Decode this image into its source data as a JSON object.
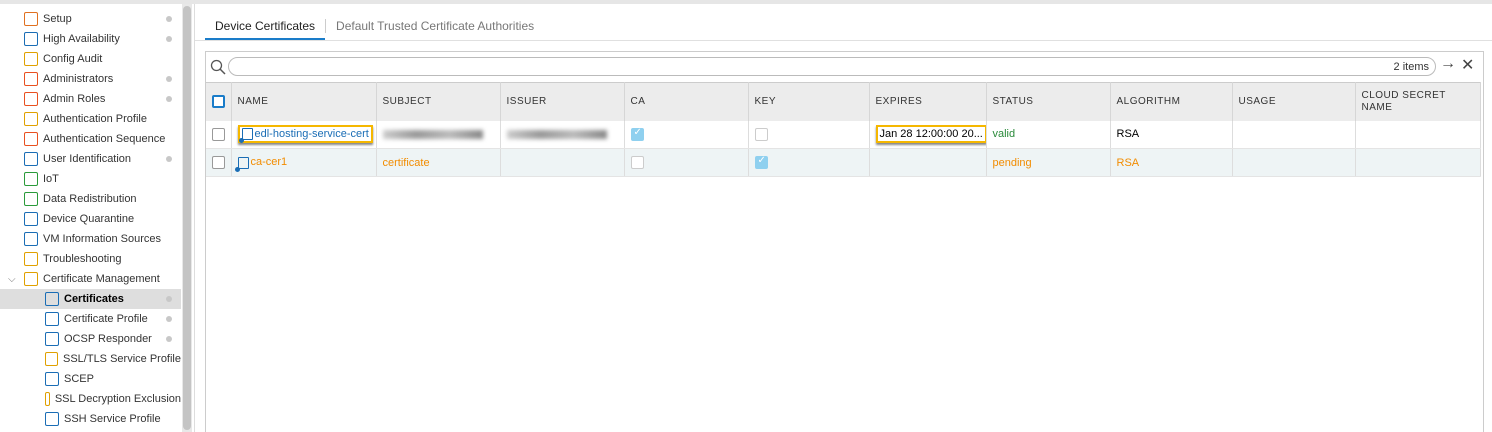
{
  "sidebar": {
    "items": [
      {
        "label": "Setup",
        "dot": true,
        "color": "#e07020"
      },
      {
        "label": "High Availability",
        "dot": true,
        "color": "#1a6db5"
      },
      {
        "label": "Config Audit",
        "dot": false,
        "color": "#e0a000"
      },
      {
        "label": "Administrators",
        "dot": true,
        "color": "#e85020"
      },
      {
        "label": "Admin Roles",
        "dot": true,
        "color": "#e85020"
      },
      {
        "label": "Authentication Profile",
        "dot": false,
        "color": "#e0a000"
      },
      {
        "label": "Authentication Sequence",
        "dot": false,
        "color": "#e85020"
      },
      {
        "label": "User Identification",
        "dot": true,
        "color": "#1a6db5"
      },
      {
        "label": "IoT",
        "dot": false,
        "color": "#2a9a3a"
      },
      {
        "label": "Data Redistribution",
        "dot": false,
        "color": "#2a9a3a"
      },
      {
        "label": "Device Quarantine",
        "dot": false,
        "color": "#1a6db5"
      },
      {
        "label": "VM Information Sources",
        "dot": false,
        "color": "#1a6db5"
      },
      {
        "label": "Troubleshooting",
        "dot": false,
        "color": "#e0a000"
      },
      {
        "label": "Certificate Management",
        "dot": false,
        "color": "#e0a000"
      },
      {
        "label": "Certificates",
        "dot": true,
        "color": "#1a6db5"
      },
      {
        "label": "Certificate Profile",
        "dot": true,
        "color": "#1a6db5"
      },
      {
        "label": "OCSP Responder",
        "dot": true,
        "color": "#1a6db5"
      },
      {
        "label": "SSL/TLS Service Profile",
        "dot": false,
        "color": "#e0a000"
      },
      {
        "label": "SCEP",
        "dot": false,
        "color": "#1a6db5"
      },
      {
        "label": "SSL Decryption Exclusion",
        "dot": false,
        "color": "#e0a000"
      },
      {
        "label": "SSH Service Profile",
        "dot": false,
        "color": "#1a6db5"
      }
    ]
  },
  "tabs": [
    "Device Certificates",
    "Default Trusted Certificate Authorities"
  ],
  "toolbar": {
    "count": "2 items",
    "search_placeholder": ""
  },
  "table": {
    "headers": [
      "NAME",
      "SUBJECT",
      "ISSUER",
      "CA",
      "KEY",
      "EXPIRES",
      "STATUS",
      "ALGORITHM",
      "USAGE",
      "CLOUD SECRET NAME"
    ],
    "rows": [
      {
        "name": "edl-hosting-service-cert",
        "subject": "",
        "issuer": "",
        "ca": true,
        "key": false,
        "expires": "Jan 28 12:00:00 20...",
        "status": "valid",
        "algorithm": "RSA",
        "usage": "",
        "cloud": ""
      },
      {
        "name": "ca-cer1",
        "subject": "certificate",
        "issuer": "",
        "ca": false,
        "key": true,
        "expires": "",
        "status": "pending",
        "algorithm": "RSA",
        "usage": "",
        "cloud": ""
      }
    ]
  }
}
